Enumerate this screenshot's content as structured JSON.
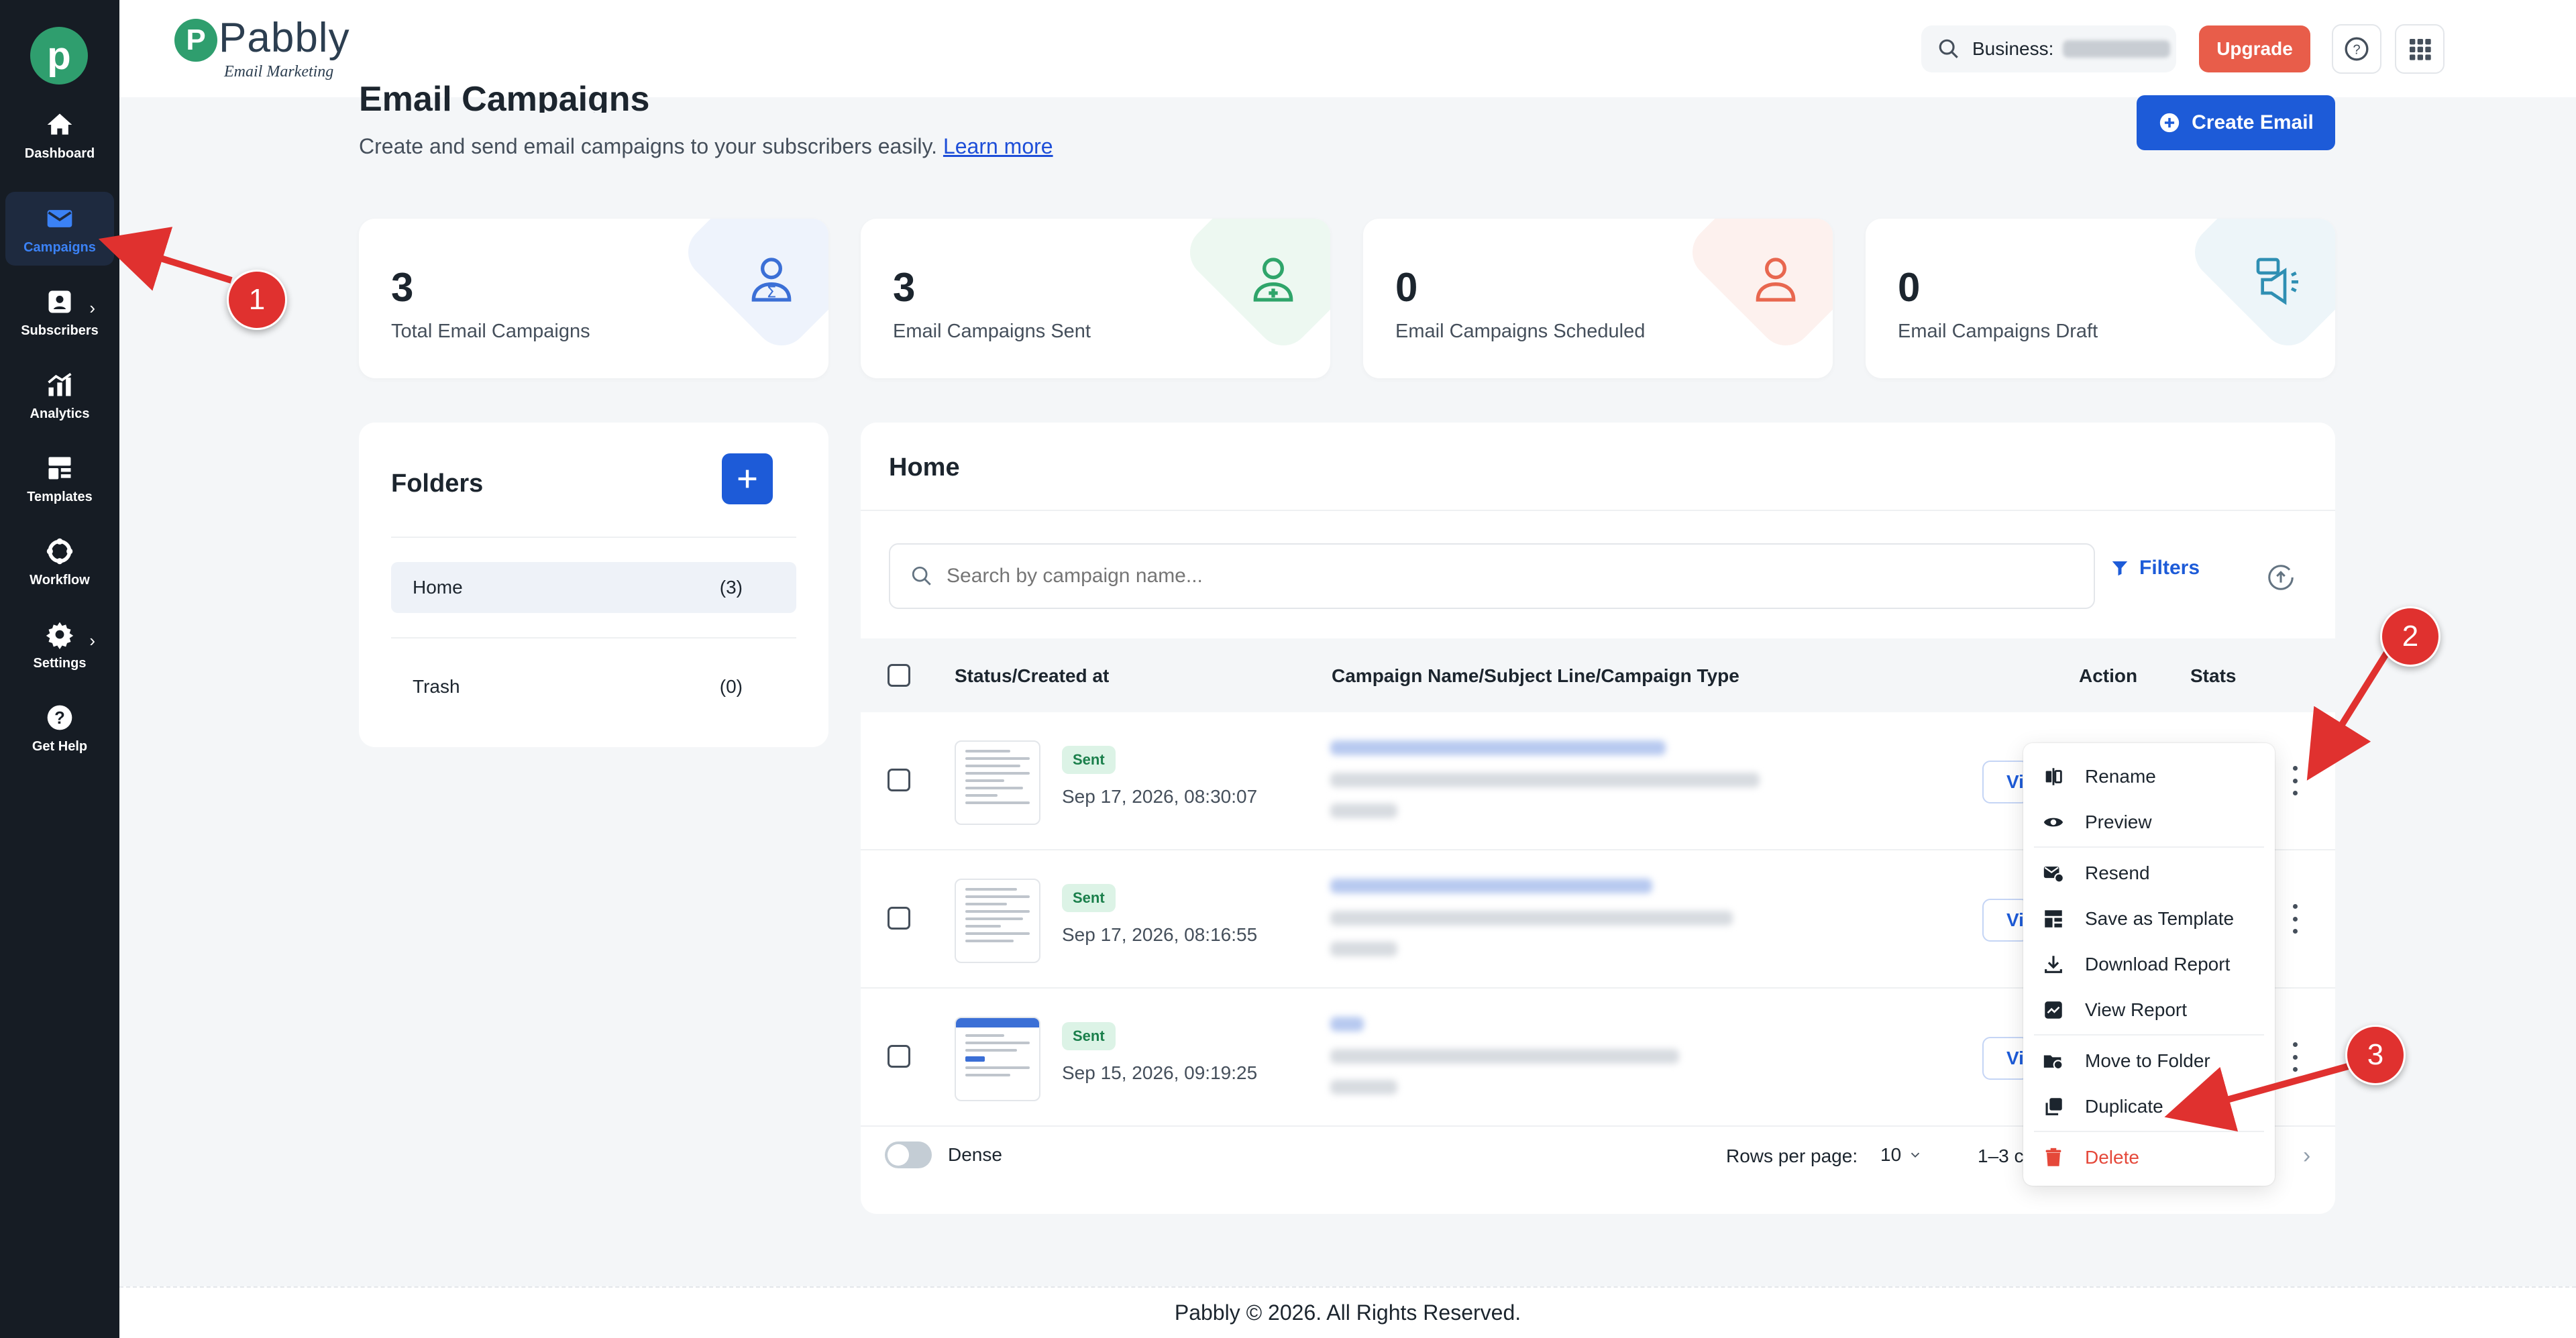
{
  "sidebar": {
    "logo_letter": "p",
    "items": [
      {
        "label": "Dashboard",
        "icon": "home-icon"
      },
      {
        "label": "Campaigns",
        "icon": "mail-icon"
      },
      {
        "label": "Subscribers",
        "icon": "subscribers-icon"
      },
      {
        "label": "Analytics",
        "icon": "analytics-icon"
      },
      {
        "label": "Templates",
        "icon": "templates-icon"
      },
      {
        "label": "Workflow",
        "icon": "workflow-icon"
      },
      {
        "label": "Settings",
        "icon": "gear-icon"
      },
      {
        "label": "Get Help",
        "icon": "help-icon"
      }
    ]
  },
  "header": {
    "brand_name": "Pabbly",
    "brand_sub": "Email Marketing",
    "brand_letter": "P",
    "business_label": "Business:",
    "upgrade_label": "Upgrade"
  },
  "page": {
    "title": "Email Campaigns",
    "subtitle": "Create and send email campaigns to your subscribers easily.",
    "learn_more": "Learn more",
    "create_label": "Create Email"
  },
  "stats": [
    {
      "value": "3",
      "label": "Total Email Campaigns",
      "color": "#3b6fd6"
    },
    {
      "value": "3",
      "label": "Email Campaigns Sent",
      "color": "#2fa56a"
    },
    {
      "value": "0",
      "label": "Email Campaigns Scheduled",
      "color": "#e8674f"
    },
    {
      "value": "0",
      "label": "Email Campaigns Draft",
      "color": "#2f8fb3"
    }
  ],
  "folders": {
    "title": "Folders",
    "items": [
      {
        "name": "Home",
        "count": "(3)"
      },
      {
        "name": "Trash",
        "count": "(0)"
      }
    ]
  },
  "campaigns": {
    "title": "Home",
    "search_placeholder": "Search by campaign name...",
    "filters_label": "Filters",
    "columns": {
      "status": "Status/Created at",
      "name": "Campaign Name/Subject Line/Campaign Type",
      "action": "Action",
      "stats": "Stats"
    },
    "rows": [
      {
        "status": "Sent",
        "created": "Sep 17, 2026, 08:30:07",
        "view": "View"
      },
      {
        "status": "Sent",
        "created": "Sep 17, 2026, 08:16:55",
        "view": "View"
      },
      {
        "status": "Sent",
        "created": "Sep 15, 2026, 09:19:25",
        "view": "View"
      }
    ],
    "dense_label": "Dense",
    "rows_per_page_label": "Rows per page:",
    "rows_per_page_value": "10",
    "pagination_info": "1–3 c"
  },
  "menu": {
    "items": [
      {
        "label": "Rename",
        "icon": "rename-icon"
      },
      {
        "label": "Preview",
        "icon": "eye-icon"
      },
      {
        "label": "Resend",
        "icon": "resend-icon"
      },
      {
        "label": "Save as Template",
        "icon": "template-icon"
      },
      {
        "label": "Download Report",
        "icon": "download-icon"
      },
      {
        "label": "View Report",
        "icon": "report-icon"
      },
      {
        "label": "Move to Folder",
        "icon": "move-folder-icon"
      },
      {
        "label": "Duplicate",
        "icon": "duplicate-icon"
      },
      {
        "label": "Delete",
        "icon": "trash-icon",
        "color": "#e5483a"
      }
    ]
  },
  "annotations": [
    "1",
    "2",
    "3"
  ],
  "footer": {
    "text": "Pabbly © 2026. All Rights Reserved."
  }
}
